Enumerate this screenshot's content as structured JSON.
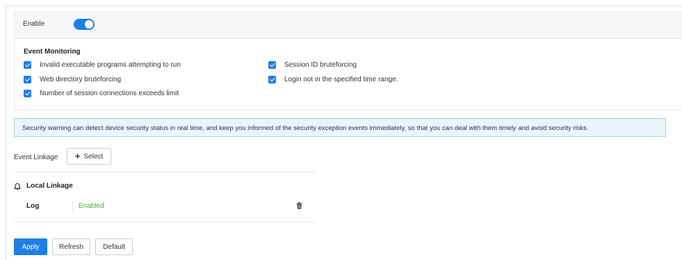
{
  "enable": {
    "label": "Enable",
    "on": true
  },
  "event_monitoring": {
    "title": "Event Monitoring",
    "items": [
      {
        "label": "Invalid executable programs attempting to run",
        "checked": true
      },
      {
        "label": "Session ID bruteforcing",
        "checked": true
      },
      {
        "label": "Web directory bruteforcing",
        "checked": true
      },
      {
        "label": "Login not in the specified time range.",
        "checked": true
      },
      {
        "label": "Number of session connections exceeds limit",
        "checked": true
      }
    ]
  },
  "info_text": "Security warning can detect device security status in real time, and keep you informed of the security exception events immediately, so that you can deal with them timely and avoid security risks.",
  "event_linkage": {
    "label": "Event Linkage",
    "select_label": "Select"
  },
  "local_linkage": {
    "title": "Local Linkage",
    "rows": [
      {
        "name": "Log",
        "status": "Enabled"
      }
    ]
  },
  "buttons": {
    "apply": "Apply",
    "refresh": "Refresh",
    "default": "Default"
  },
  "colors": {
    "accent": "#1f7ee8",
    "enabled_status": "#4caf2e",
    "info_bg": "#e8f6fb"
  }
}
